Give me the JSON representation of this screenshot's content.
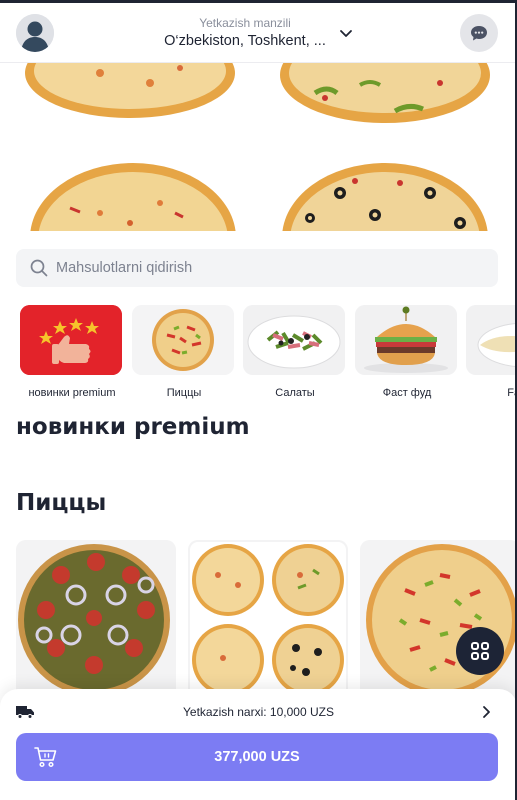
{
  "header": {
    "address_label": "Yetkazish manzili",
    "address_value": "O‘zbekiston, Toshkent, ...",
    "avatar_icon": "user-avatar-icon",
    "dropdown_icon": "chevron-down-icon",
    "chat_icon": "chat-icon"
  },
  "search": {
    "placeholder": "Mahsulotlarni qidirish",
    "icon": "search-icon"
  },
  "categories": [
    {
      "label": "новинки premium"
    },
    {
      "label": "Пиццы"
    },
    {
      "label": "Салаты"
    },
    {
      "label": "Фаст фуд"
    },
    {
      "label": "Fast"
    }
  ],
  "sections": {
    "premium_title": "новинки premium",
    "pizza_title": "Пиццы"
  },
  "cart": {
    "delivery_fee": "Yetkazish narxi: 10,000 UZS",
    "total": "377,000 UZS",
    "truck_icon": "delivery-truck-icon",
    "cart_icon": "cart-icon"
  },
  "colors": {
    "accent": "#7c7cf3",
    "dark": "#1d2436",
    "promo_red": "#e3232a"
  }
}
